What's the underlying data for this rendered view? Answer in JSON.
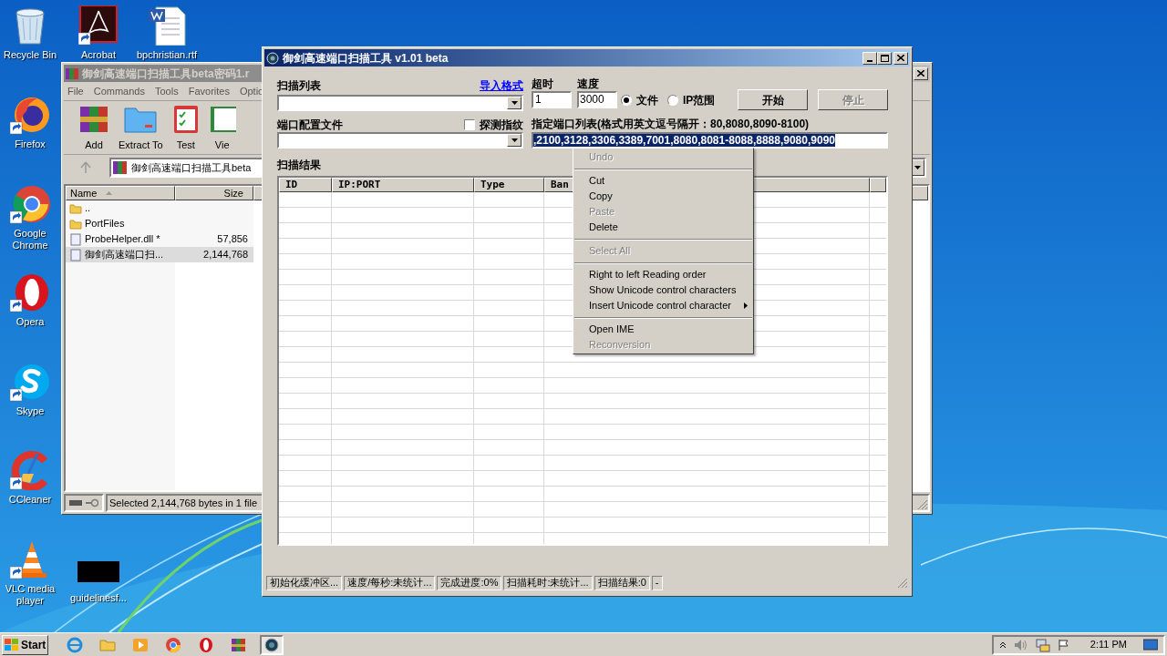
{
  "desktop_icons": [
    {
      "label": "Recycle Bin"
    },
    {
      "label": "Acrobat"
    },
    {
      "label": "bpchristian.rtf"
    },
    {
      "label": "Firefox"
    },
    {
      "label": "Google Chrome"
    },
    {
      "label": "Opera"
    },
    {
      "label": "Skype"
    },
    {
      "label": "CCleaner"
    },
    {
      "label": "VLC media player"
    },
    {
      "label": "guidelinesf..."
    }
  ],
  "archiver": {
    "title": "御剑高速端口扫描工具beta密码1.r",
    "menu": [
      "File",
      "Commands",
      "Tools",
      "Favorites",
      "Optio"
    ],
    "toolbar": [
      "Add",
      "Extract To",
      "Test",
      "Vie"
    ],
    "address": "御剑高速端口扫描工具beta",
    "columns": [
      "Name",
      "Size"
    ],
    "rows": [
      {
        "name": "..",
        "size": "",
        "selected": false
      },
      {
        "name": "PortFiles",
        "size": "",
        "selected": false
      },
      {
        "name": "ProbeHelper.dll *",
        "size": "57,856",
        "selected": false
      },
      {
        "name": "御剑高速端口扫...",
        "size": "2,144,768",
        "selected": true
      }
    ],
    "status": "Selected 2,144,768 bytes in 1 file"
  },
  "scanner": {
    "title": "御剑高速端口扫描工具 v1.01 beta",
    "scan_list": {
      "label": "扫描列表",
      "link": "导入格式"
    },
    "timeout": {
      "label": "超时",
      "value": "1"
    },
    "speed": {
      "label": "速度",
      "value": "3000"
    },
    "mode": [
      {
        "label": "文件",
        "selected": true
      },
      {
        "label": "IP范围",
        "selected": false
      }
    ],
    "buttons": [
      {
        "label": "开始",
        "disabled": false
      },
      {
        "label": "停止",
        "disabled": true
      }
    ],
    "port_config": {
      "label": "端口配置文件"
    },
    "fingerprint": {
      "label": "探测指纹",
      "checked": false
    },
    "port_list": {
      "label": "指定端口列表(格式用英文逗号隔开：80,8080,8090-8100)",
      "value": ",2100,3128,3306,3389,7001,8080,8081-8088,8888,9080,9090"
    },
    "results": {
      "label": "扫描结果",
      "columns": [
        "ID",
        "IP:PORT",
        "Type",
        "Ban"
      ]
    },
    "status_bar": [
      "初始化缓冲区...",
      "速度/每秒:未统计...",
      "完成进度:0%",
      "扫描耗时:未统计...",
      "扫描结果:0",
      "-"
    ]
  },
  "context_menu": [
    {
      "kind": "item",
      "label": "Undo",
      "disabled": true,
      "submenu": false
    },
    {
      "kind": "separator"
    },
    {
      "kind": "item",
      "label": "Cut",
      "disabled": false,
      "submenu": false
    },
    {
      "kind": "item",
      "label": "Copy",
      "disabled": false,
      "submenu": false
    },
    {
      "kind": "item",
      "label": "Paste",
      "disabled": true,
      "submenu": false
    },
    {
      "kind": "item",
      "label": "Delete",
      "disabled": false,
      "submenu": false
    },
    {
      "kind": "separator"
    },
    {
      "kind": "item",
      "label": "Select All",
      "disabled": true,
      "submenu": false
    },
    {
      "kind": "separator"
    },
    {
      "kind": "item",
      "label": "Right to left Reading order",
      "disabled": false,
      "submenu": false
    },
    {
      "kind": "item",
      "label": "Show Unicode control characters",
      "disabled": false,
      "submenu": false
    },
    {
      "kind": "item",
      "label": "Insert Unicode control character",
      "disabled": false,
      "submenu": true
    },
    {
      "kind": "separator"
    },
    {
      "kind": "item",
      "label": "Open IME",
      "disabled": false,
      "submenu": false
    },
    {
      "kind": "item",
      "label": "Reconversion",
      "disabled": true,
      "submenu": false
    }
  ],
  "taskbar": {
    "start": "Start",
    "apps": [
      {
        "selected": false
      },
      {
        "selected": false
      },
      {
        "selected": false
      },
      {
        "selected": false
      },
      {
        "selected": false
      },
      {
        "selected": false
      },
      {
        "selected": true
      }
    ],
    "clock": "2:11 PM"
  }
}
